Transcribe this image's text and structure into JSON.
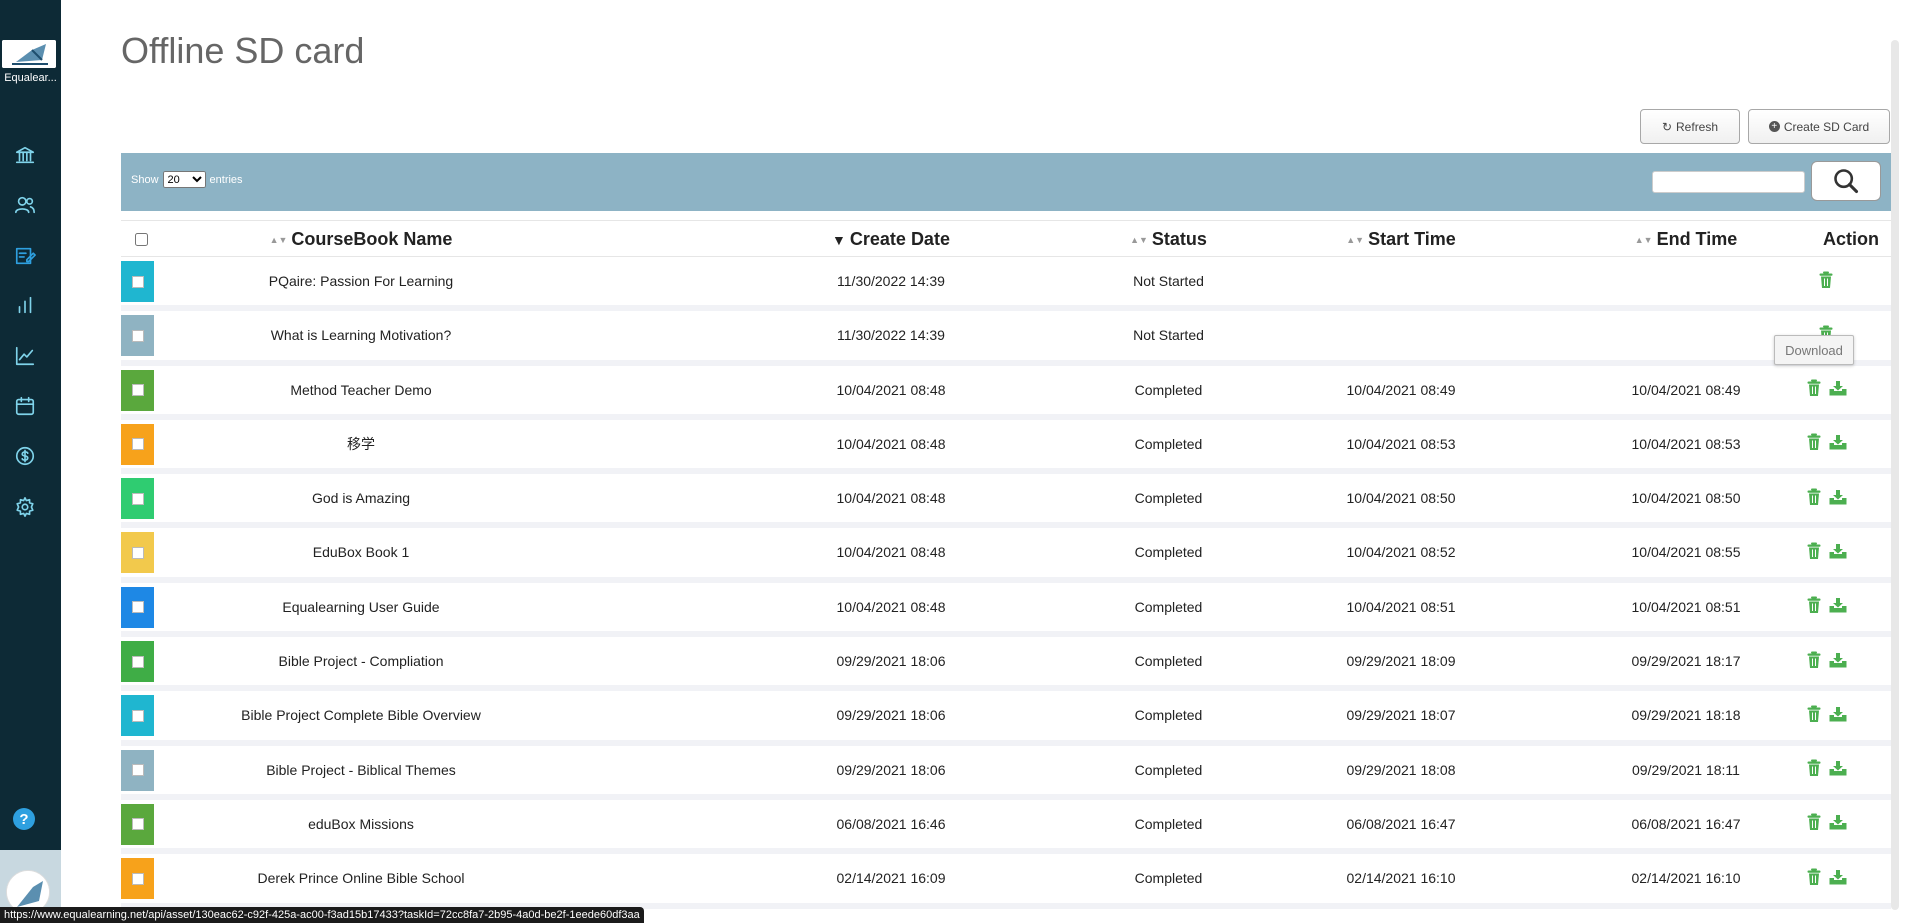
{
  "sidebar": {
    "logo_text": "Equalear...",
    "nav": [
      "institution-icon",
      "users-icon",
      "edit-icon",
      "bar-chart-icon",
      "line-chart-icon",
      "calendar-icon",
      "money-icon",
      "gear-icon"
    ],
    "active_color": "#2ea0e0",
    "icon_color": "#7fd3ea"
  },
  "page": {
    "title": "Offline SD card"
  },
  "buttons": {
    "refresh": "Refresh",
    "create": "Create SD Card"
  },
  "toolbar": {
    "show_label": "Show",
    "show_value": "20",
    "entries_label": "entries",
    "search_placeholder": ""
  },
  "table": {
    "headers": {
      "name": "CourseBook Name",
      "date": "Create Date",
      "status": "Status",
      "start": "Start Time",
      "end": "End Time",
      "action": "Action"
    },
    "rows": [
      {
        "color": "#1fb6d0",
        "name": "PQaire: Passion For Learning",
        "date": "11/30/2022 14:39",
        "status": "Not Started",
        "start": "",
        "end": "",
        "download": false
      },
      {
        "color": "#8fb3c2",
        "name": "What is Learning Motivation?",
        "date": "11/30/2022 14:39",
        "status": "Not Started",
        "start": "",
        "end": "",
        "download": false
      },
      {
        "color": "#5aa83d",
        "name": "Method Teacher Demo",
        "date": "10/04/2021 08:48",
        "status": "Completed",
        "start": "10/04/2021 08:49",
        "end": "10/04/2021 08:49",
        "download": true
      },
      {
        "color": "#f7a21b",
        "name": "移学",
        "date": "10/04/2021 08:48",
        "status": "Completed",
        "start": "10/04/2021 08:53",
        "end": "10/04/2021 08:53",
        "download": true
      },
      {
        "color": "#2fcc71",
        "name": "God is Amazing",
        "date": "10/04/2021 08:48",
        "status": "Completed",
        "start": "10/04/2021 08:50",
        "end": "10/04/2021 08:50",
        "download": true
      },
      {
        "color": "#f2c94c",
        "name": "EduBox Book 1",
        "date": "10/04/2021 08:48",
        "status": "Completed",
        "start": "10/04/2021 08:52",
        "end": "10/04/2021 08:55",
        "download": true
      },
      {
        "color": "#1e88e5",
        "name": "Equalearning User Guide",
        "date": "10/04/2021 08:48",
        "status": "Completed",
        "start": "10/04/2021 08:51",
        "end": "10/04/2021 08:51",
        "download": true
      },
      {
        "color": "#3fad46",
        "name": "Bible Project - Compliation",
        "date": "09/29/2021 18:06",
        "status": "Completed",
        "start": "09/29/2021 18:09",
        "end": "09/29/2021 18:17",
        "download": true
      },
      {
        "color": "#1fb6d0",
        "name": "Bible Project Complete Bible Overview",
        "date": "09/29/2021 18:06",
        "status": "Completed",
        "start": "09/29/2021 18:07",
        "end": "09/29/2021 18:18",
        "download": true
      },
      {
        "color": "#8fb3c2",
        "name": "Bible Project - Biblical Themes",
        "date": "09/29/2021 18:06",
        "status": "Completed",
        "start": "09/29/2021 18:08",
        "end": "09/29/2021 18:11",
        "download": true
      },
      {
        "color": "#5aa83d",
        "name": "eduBox Missions",
        "date": "06/08/2021 16:46",
        "status": "Completed",
        "start": "06/08/2021 16:47",
        "end": "06/08/2021 16:47",
        "download": true
      },
      {
        "color": "#f7a21b",
        "name": "Derek Prince Online Bible School",
        "date": "02/14/2021 16:09",
        "status": "Completed",
        "start": "02/14/2021 16:10",
        "end": "02/14/2021 16:10",
        "download": true
      }
    ]
  },
  "tooltip": "Download",
  "status_url": "https://www.equalearning.net/api/asset/130eac62-c92f-425a-ac00-f3ad15b17433?taskId=72cc8fa7-2b95-4a0d-be2f-1eede60df3aa",
  "accent": "#4caf50"
}
